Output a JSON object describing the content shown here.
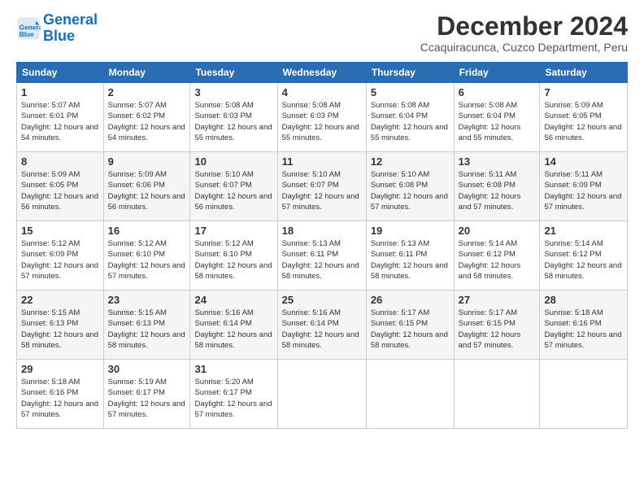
{
  "logo": {
    "line1": "General",
    "line2": "Blue"
  },
  "title": "December 2024",
  "location": "Ccaquiracunca, Cuzco Department, Peru",
  "days_of_week": [
    "Sunday",
    "Monday",
    "Tuesday",
    "Wednesday",
    "Thursday",
    "Friday",
    "Saturday"
  ],
  "weeks": [
    [
      {
        "day": "1",
        "sunrise": "5:07 AM",
        "sunset": "6:01 PM",
        "daylight": "12 hours and 54 minutes."
      },
      {
        "day": "2",
        "sunrise": "5:07 AM",
        "sunset": "6:02 PM",
        "daylight": "12 hours and 54 minutes."
      },
      {
        "day": "3",
        "sunrise": "5:08 AM",
        "sunset": "6:03 PM",
        "daylight": "12 hours and 55 minutes."
      },
      {
        "day": "4",
        "sunrise": "5:08 AM",
        "sunset": "6:03 PM",
        "daylight": "12 hours and 55 minutes."
      },
      {
        "day": "5",
        "sunrise": "5:08 AM",
        "sunset": "6:04 PM",
        "daylight": "12 hours and 55 minutes."
      },
      {
        "day": "6",
        "sunrise": "5:08 AM",
        "sunset": "6:04 PM",
        "daylight": "12 hours and 55 minutes."
      },
      {
        "day": "7",
        "sunrise": "5:09 AM",
        "sunset": "6:05 PM",
        "daylight": "12 hours and 56 minutes."
      }
    ],
    [
      {
        "day": "8",
        "sunrise": "5:09 AM",
        "sunset": "6:05 PM",
        "daylight": "12 hours and 56 minutes."
      },
      {
        "day": "9",
        "sunrise": "5:09 AM",
        "sunset": "6:06 PM",
        "daylight": "12 hours and 56 minutes."
      },
      {
        "day": "10",
        "sunrise": "5:10 AM",
        "sunset": "6:07 PM",
        "daylight": "12 hours and 56 minutes."
      },
      {
        "day": "11",
        "sunrise": "5:10 AM",
        "sunset": "6:07 PM",
        "daylight": "12 hours and 57 minutes."
      },
      {
        "day": "12",
        "sunrise": "5:10 AM",
        "sunset": "6:08 PM",
        "daylight": "12 hours and 57 minutes."
      },
      {
        "day": "13",
        "sunrise": "5:11 AM",
        "sunset": "6:08 PM",
        "daylight": "12 hours and 57 minutes."
      },
      {
        "day": "14",
        "sunrise": "5:11 AM",
        "sunset": "6:09 PM",
        "daylight": "12 hours and 57 minutes."
      }
    ],
    [
      {
        "day": "15",
        "sunrise": "5:12 AM",
        "sunset": "6:09 PM",
        "daylight": "12 hours and 57 minutes."
      },
      {
        "day": "16",
        "sunrise": "5:12 AM",
        "sunset": "6:10 PM",
        "daylight": "12 hours and 57 minutes."
      },
      {
        "day": "17",
        "sunrise": "5:12 AM",
        "sunset": "6:10 PM",
        "daylight": "12 hours and 58 minutes."
      },
      {
        "day": "18",
        "sunrise": "5:13 AM",
        "sunset": "6:11 PM",
        "daylight": "12 hours and 58 minutes."
      },
      {
        "day": "19",
        "sunrise": "5:13 AM",
        "sunset": "6:11 PM",
        "daylight": "12 hours and 58 minutes."
      },
      {
        "day": "20",
        "sunrise": "5:14 AM",
        "sunset": "6:12 PM",
        "daylight": "12 hours and 58 minutes."
      },
      {
        "day": "21",
        "sunrise": "5:14 AM",
        "sunset": "6:12 PM",
        "daylight": "12 hours and 58 minutes."
      }
    ],
    [
      {
        "day": "22",
        "sunrise": "5:15 AM",
        "sunset": "6:13 PM",
        "daylight": "12 hours and 58 minutes."
      },
      {
        "day": "23",
        "sunrise": "5:15 AM",
        "sunset": "6:13 PM",
        "daylight": "12 hours and 58 minutes."
      },
      {
        "day": "24",
        "sunrise": "5:16 AM",
        "sunset": "6:14 PM",
        "daylight": "12 hours and 58 minutes."
      },
      {
        "day": "25",
        "sunrise": "5:16 AM",
        "sunset": "6:14 PM",
        "daylight": "12 hours and 58 minutes."
      },
      {
        "day": "26",
        "sunrise": "5:17 AM",
        "sunset": "6:15 PM",
        "daylight": "12 hours and 58 minutes."
      },
      {
        "day": "27",
        "sunrise": "5:17 AM",
        "sunset": "6:15 PM",
        "daylight": "12 hours and 57 minutes."
      },
      {
        "day": "28",
        "sunrise": "5:18 AM",
        "sunset": "6:16 PM",
        "daylight": "12 hours and 57 minutes."
      }
    ],
    [
      {
        "day": "29",
        "sunrise": "5:18 AM",
        "sunset": "6:16 PM",
        "daylight": "12 hours and 57 minutes."
      },
      {
        "day": "30",
        "sunrise": "5:19 AM",
        "sunset": "6:17 PM",
        "daylight": "12 hours and 57 minutes."
      },
      {
        "day": "31",
        "sunrise": "5:20 AM",
        "sunset": "6:17 PM",
        "daylight": "12 hours and 57 minutes."
      },
      null,
      null,
      null,
      null
    ]
  ]
}
